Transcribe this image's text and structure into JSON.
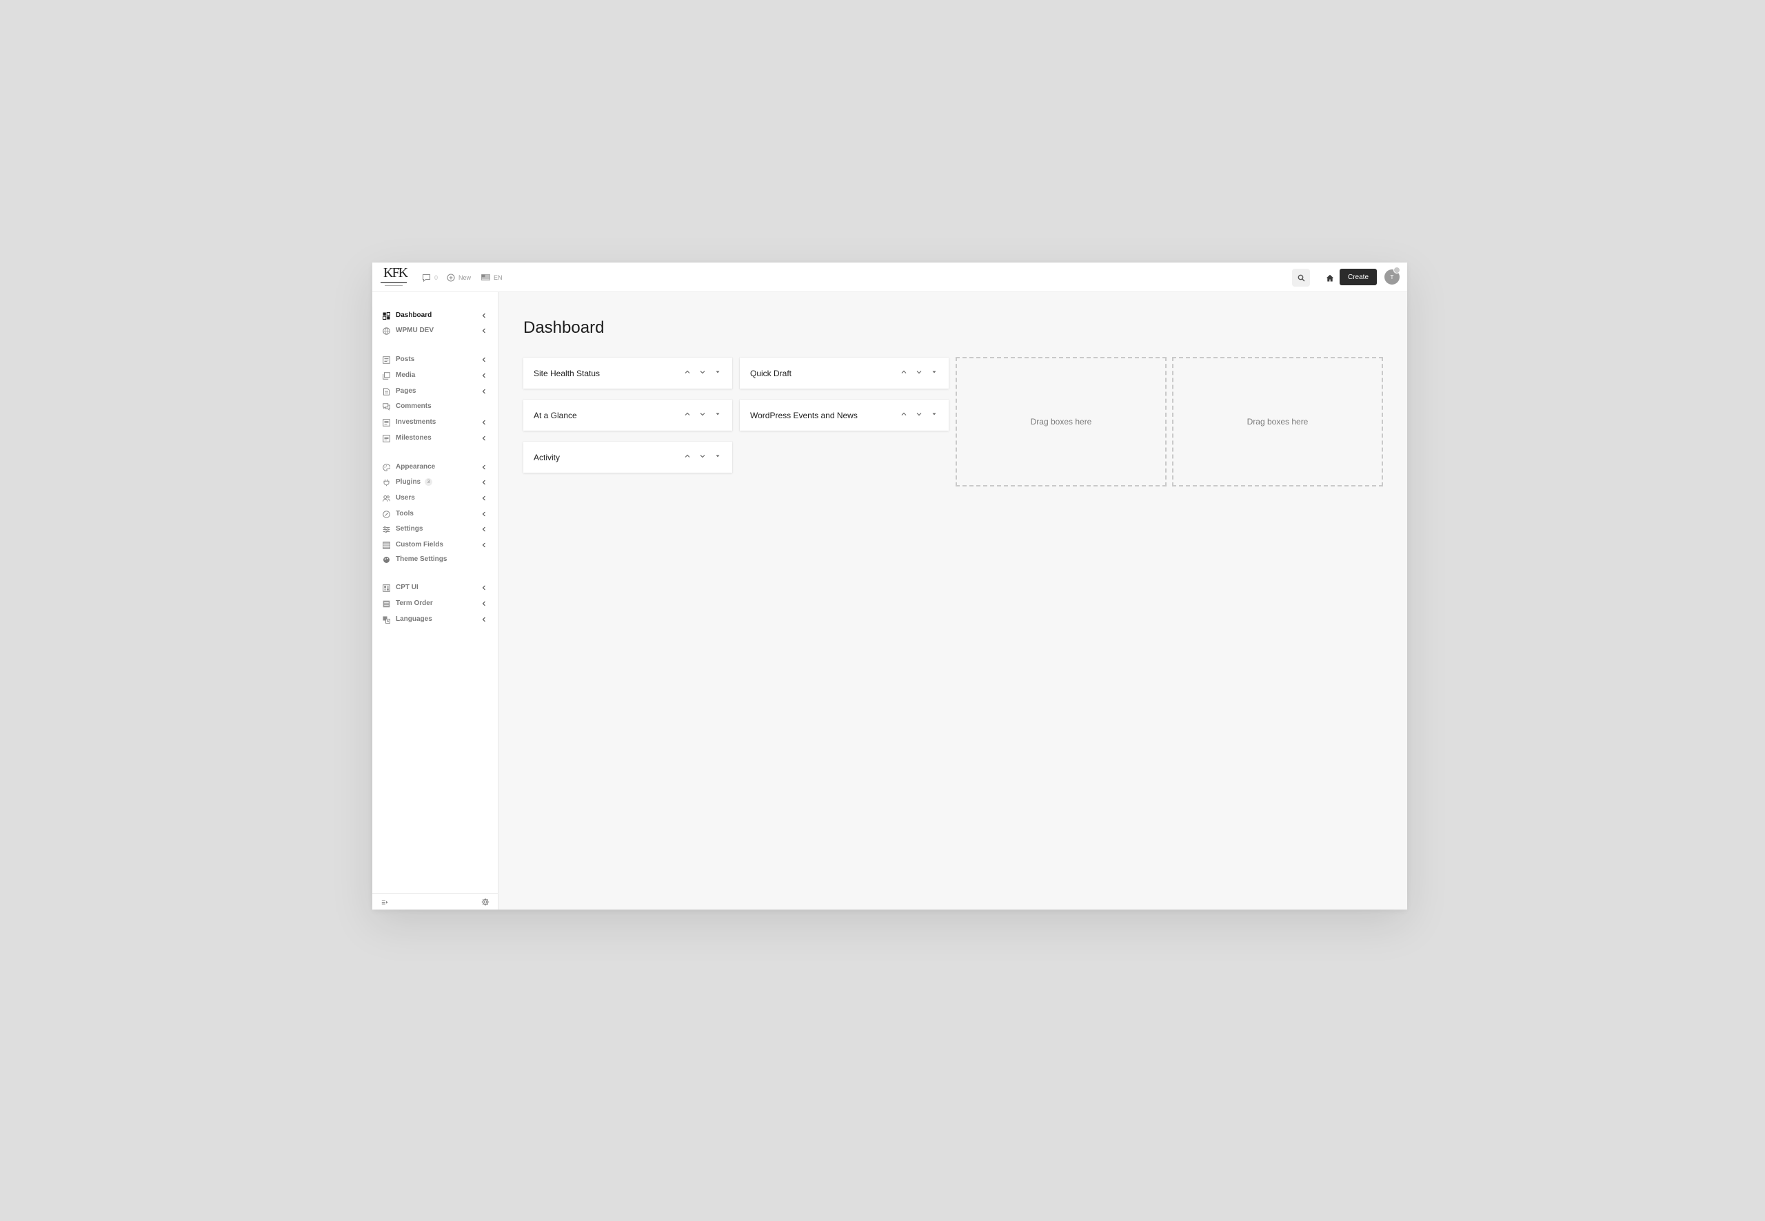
{
  "topbar": {
    "logo_text": "KFK",
    "comments_count": "0",
    "new_label": "New",
    "language_label": "EN",
    "create_label": "Create",
    "avatar_initial": "T"
  },
  "sidebar": {
    "items": [
      {
        "label": "Dashboard",
        "icon": "dashboard-icon",
        "active": true,
        "submenu": true
      },
      {
        "label": "WPMU DEV",
        "icon": "globe-icon",
        "submenu": true
      },
      {
        "label": "Posts",
        "icon": "posts-icon",
        "submenu": true
      },
      {
        "label": "Media",
        "icon": "media-icon",
        "submenu": true
      },
      {
        "label": "Pages",
        "icon": "pages-icon",
        "submenu": true
      },
      {
        "label": "Comments",
        "icon": "comments-icon",
        "submenu": false
      },
      {
        "label": "Investments",
        "icon": "investments-icon",
        "submenu": true
      },
      {
        "label": "Milestones",
        "icon": "milestones-icon",
        "submenu": true
      },
      {
        "label": "Appearance",
        "icon": "appearance-icon",
        "submenu": true
      },
      {
        "label": "Plugins",
        "icon": "plugins-icon",
        "submenu": true,
        "badge": "3"
      },
      {
        "label": "Users",
        "icon": "users-icon",
        "submenu": true
      },
      {
        "label": "Tools",
        "icon": "tools-icon",
        "submenu": true
      },
      {
        "label": "Settings",
        "icon": "settings-icon",
        "submenu": true
      },
      {
        "label": "Custom Fields",
        "icon": "custom-fields-icon",
        "submenu": true
      },
      {
        "label": "Theme Settings",
        "icon": "theme-settings-icon",
        "submenu": false
      },
      {
        "label": "CPT UI",
        "icon": "cpt-ui-icon",
        "submenu": true
      },
      {
        "label": "Term Order",
        "icon": "term-order-icon",
        "submenu": true
      },
      {
        "label": "Languages",
        "icon": "languages-icon",
        "submenu": true
      }
    ]
  },
  "main": {
    "title": "Dashboard",
    "widgets": [
      {
        "title": "Site Health Status"
      },
      {
        "title": "At a Glance"
      },
      {
        "title": "Activity"
      },
      {
        "title": "Quick Draft"
      },
      {
        "title": "WordPress Events and News"
      }
    ],
    "dropzone_label": "Drag boxes here"
  },
  "colors": {
    "background": "#dedede",
    "panel": "#f7f7f7",
    "primary_button": "#2b2b2b"
  }
}
